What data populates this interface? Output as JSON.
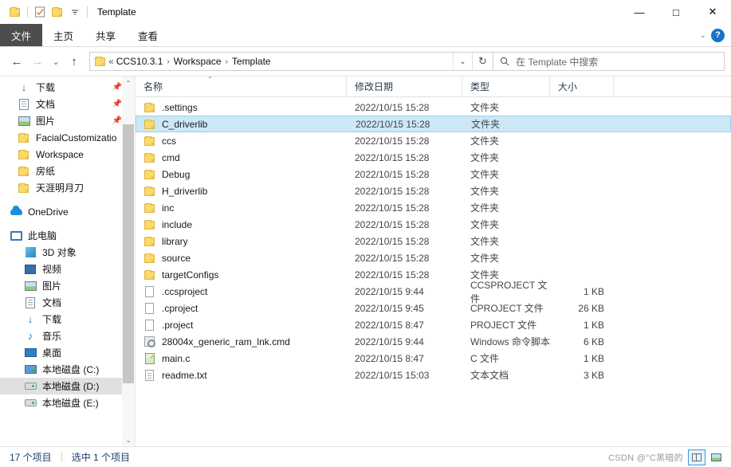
{
  "window": {
    "title": "Template",
    "minimize_label": "—",
    "maximize_label": "□",
    "close_label": "✕"
  },
  "quick_access": {
    "folder_icon": "folder-icon",
    "properties_icon": "properties-icon",
    "new_folder_icon": "new-folder-icon",
    "dropdown_label": "☰"
  },
  "ribbon": {
    "tabs": [
      {
        "label": "文件",
        "active": true
      },
      {
        "label": "主页",
        "active": false
      },
      {
        "label": "共享",
        "active": false
      },
      {
        "label": "查看",
        "active": false
      }
    ],
    "collapse_label": "⌄",
    "help_label": "?"
  },
  "nav": {
    "back_label": "←",
    "forward_label": "→",
    "recent_label": "⌄",
    "up_label": "↑",
    "refresh_label": "↻",
    "address_dropdown_label": "⌄",
    "breadcrumb_prefix": "«",
    "breadcrumbs": [
      "CCS10.3.1",
      "Workspace",
      "Template"
    ],
    "crumb_separator": "›"
  },
  "search": {
    "icon": "search-icon",
    "placeholder": "在 Template 中搜索",
    "value": ""
  },
  "sidebar": {
    "groups": [
      {
        "items": [
          {
            "label": "下载",
            "icon": "download-icon",
            "pinned": true,
            "indent": 1
          },
          {
            "label": "文档",
            "icon": "documents-icon",
            "pinned": true,
            "indent": 1
          },
          {
            "label": "图片",
            "icon": "pictures-icon",
            "pinned": true,
            "indent": 1
          },
          {
            "label": "FacialCustomizatio",
            "icon": "folder-icon",
            "pinned": false,
            "indent": 1
          },
          {
            "label": "Workspace",
            "icon": "folder-icon",
            "pinned": false,
            "indent": 1
          },
          {
            "label": "房纸",
            "icon": "folder-icon",
            "pinned": false,
            "indent": 1
          },
          {
            "label": "天涯明月刀",
            "icon": "folder-icon",
            "pinned": false,
            "indent": 1
          }
        ]
      },
      {
        "items": [
          {
            "label": "OneDrive",
            "icon": "onedrive-icon",
            "pinned": false,
            "indent": 0
          }
        ]
      },
      {
        "items": [
          {
            "label": "此电脑",
            "icon": "this-pc-icon",
            "pinned": false,
            "indent": 0
          },
          {
            "label": "3D 对象",
            "icon": "3d-objects-icon",
            "pinned": false,
            "indent": 1
          },
          {
            "label": "视频",
            "icon": "videos-icon",
            "pinned": false,
            "indent": 1
          },
          {
            "label": "图片",
            "icon": "pictures-icon",
            "pinned": false,
            "indent": 1
          },
          {
            "label": "文档",
            "icon": "documents-icon",
            "pinned": false,
            "indent": 1
          },
          {
            "label": "下载",
            "icon": "download-icon",
            "pinned": false,
            "indent": 1
          },
          {
            "label": "音乐",
            "icon": "music-icon",
            "pinned": false,
            "indent": 1
          },
          {
            "label": "桌面",
            "icon": "desktop-icon",
            "pinned": false,
            "indent": 1
          },
          {
            "label": "本地磁盘 (C:)",
            "icon": "drive-c-icon",
            "pinned": false,
            "indent": 1
          },
          {
            "label": "本地磁盘 (D:)",
            "icon": "drive-icon",
            "pinned": false,
            "indent": 1,
            "selected": true
          },
          {
            "label": "本地磁盘 (E:)",
            "icon": "drive-icon",
            "pinned": false,
            "indent": 1
          }
        ]
      }
    ],
    "scroll_up_label": "⌃",
    "scroll_down_label": "⌄"
  },
  "columns": {
    "name": "名称",
    "date": "修改日期",
    "type": "类型",
    "size": "大小",
    "sort_caret": "⌃"
  },
  "files": [
    {
      "name": ".settings",
      "date": "2022/10/15 15:28",
      "type": "文件夹",
      "size": "",
      "icon": "folder-icon",
      "selected": false
    },
    {
      "name": "C_driverlib",
      "date": "2022/10/15 15:28",
      "type": "文件夹",
      "size": "",
      "icon": "folder-icon",
      "selected": true
    },
    {
      "name": "ccs",
      "date": "2022/10/15 15:28",
      "type": "文件夹",
      "size": "",
      "icon": "folder-icon",
      "selected": false
    },
    {
      "name": "cmd",
      "date": "2022/10/15 15:28",
      "type": "文件夹",
      "size": "",
      "icon": "folder-icon",
      "selected": false
    },
    {
      "name": "Debug",
      "date": "2022/10/15 15:28",
      "type": "文件夹",
      "size": "",
      "icon": "folder-icon",
      "selected": false
    },
    {
      "name": "H_driverlib",
      "date": "2022/10/15 15:28",
      "type": "文件夹",
      "size": "",
      "icon": "folder-icon",
      "selected": false
    },
    {
      "name": "inc",
      "date": "2022/10/15 15:28",
      "type": "文件夹",
      "size": "",
      "icon": "folder-icon",
      "selected": false
    },
    {
      "name": "include",
      "date": "2022/10/15 15:28",
      "type": "文件夹",
      "size": "",
      "icon": "folder-icon",
      "selected": false
    },
    {
      "name": "library",
      "date": "2022/10/15 15:28",
      "type": "文件夹",
      "size": "",
      "icon": "folder-icon",
      "selected": false
    },
    {
      "name": "source",
      "date": "2022/10/15 15:28",
      "type": "文件夹",
      "size": "",
      "icon": "folder-icon",
      "selected": false
    },
    {
      "name": "targetConfigs",
      "date": "2022/10/15 15:28",
      "type": "文件夹",
      "size": "",
      "icon": "folder-icon",
      "selected": false
    },
    {
      "name": ".ccsproject",
      "date": "2022/10/15 9:44",
      "type": "CCSPROJECT 文件",
      "size": "1 KB",
      "icon": "document-icon",
      "selected": false
    },
    {
      "name": ".cproject",
      "date": "2022/10/15 9:45",
      "type": "CPROJECT 文件",
      "size": "26 KB",
      "icon": "document-icon",
      "selected": false
    },
    {
      "name": ".project",
      "date": "2022/10/15 8:47",
      "type": "PROJECT 文件",
      "size": "1 KB",
      "icon": "document-icon",
      "selected": false
    },
    {
      "name": "28004x_generic_ram_lnk.cmd",
      "date": "2022/10/15 9:44",
      "type": "Windows 命令脚本",
      "size": "6 KB",
      "icon": "cmd-script-icon",
      "selected": false
    },
    {
      "name": "main.c",
      "date": "2022/10/15 8:47",
      "type": "C 文件",
      "size": "1 KB",
      "icon": "c-file-icon",
      "selected": false
    },
    {
      "name": "readme.txt",
      "date": "2022/10/15 15:03",
      "type": "文本文档",
      "size": "3 KB",
      "icon": "text-file-icon",
      "selected": false
    }
  ],
  "statusbar": {
    "item_count": "17 个项目",
    "selection": "选中 1 个项目",
    "details_view_icon": "details-view-icon",
    "large_icons_view_icon": "large-icons-view-icon"
  },
  "watermark": "CSDN @°C黑暗的",
  "colors": {
    "selection_fill": "#cce8f7",
    "selection_border": "#99d1f2",
    "file_tab_bg": "#4d4d4d",
    "folder_yellow": "#fbd96b",
    "accent_blue": "#1673c7"
  }
}
